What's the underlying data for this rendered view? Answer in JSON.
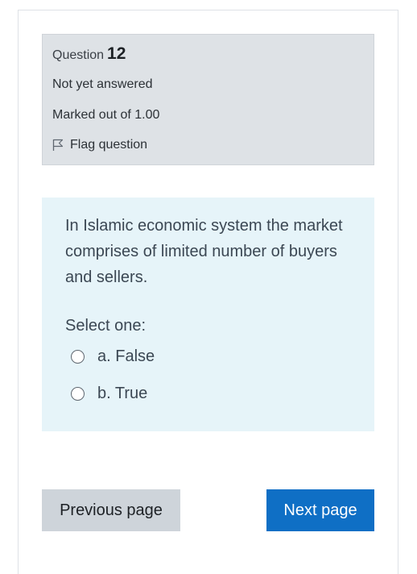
{
  "question_info": {
    "label": "Question",
    "number": "12",
    "state": "Not yet answered",
    "grade": "Marked out of 1.00",
    "flag_label": "Flag question"
  },
  "question": {
    "text": "In Islamic economic system the market comprises of limited number of buyers and sellers.",
    "prompt": "Select one:",
    "answers": [
      {
        "label": "a. False",
        "selected": false
      },
      {
        "label": "b. True",
        "selected": false
      }
    ]
  },
  "navigation": {
    "previous_label": "Previous page",
    "next_label": "Next page"
  },
  "colors": {
    "info_background": "#dee2e6",
    "content_background": "#e6f4f9",
    "primary_button": "#0f6fc5",
    "secondary_button": "#ced4da"
  },
  "icons": {
    "flag": "flag-outline-icon",
    "radio": "radio-unchecked-icon"
  }
}
